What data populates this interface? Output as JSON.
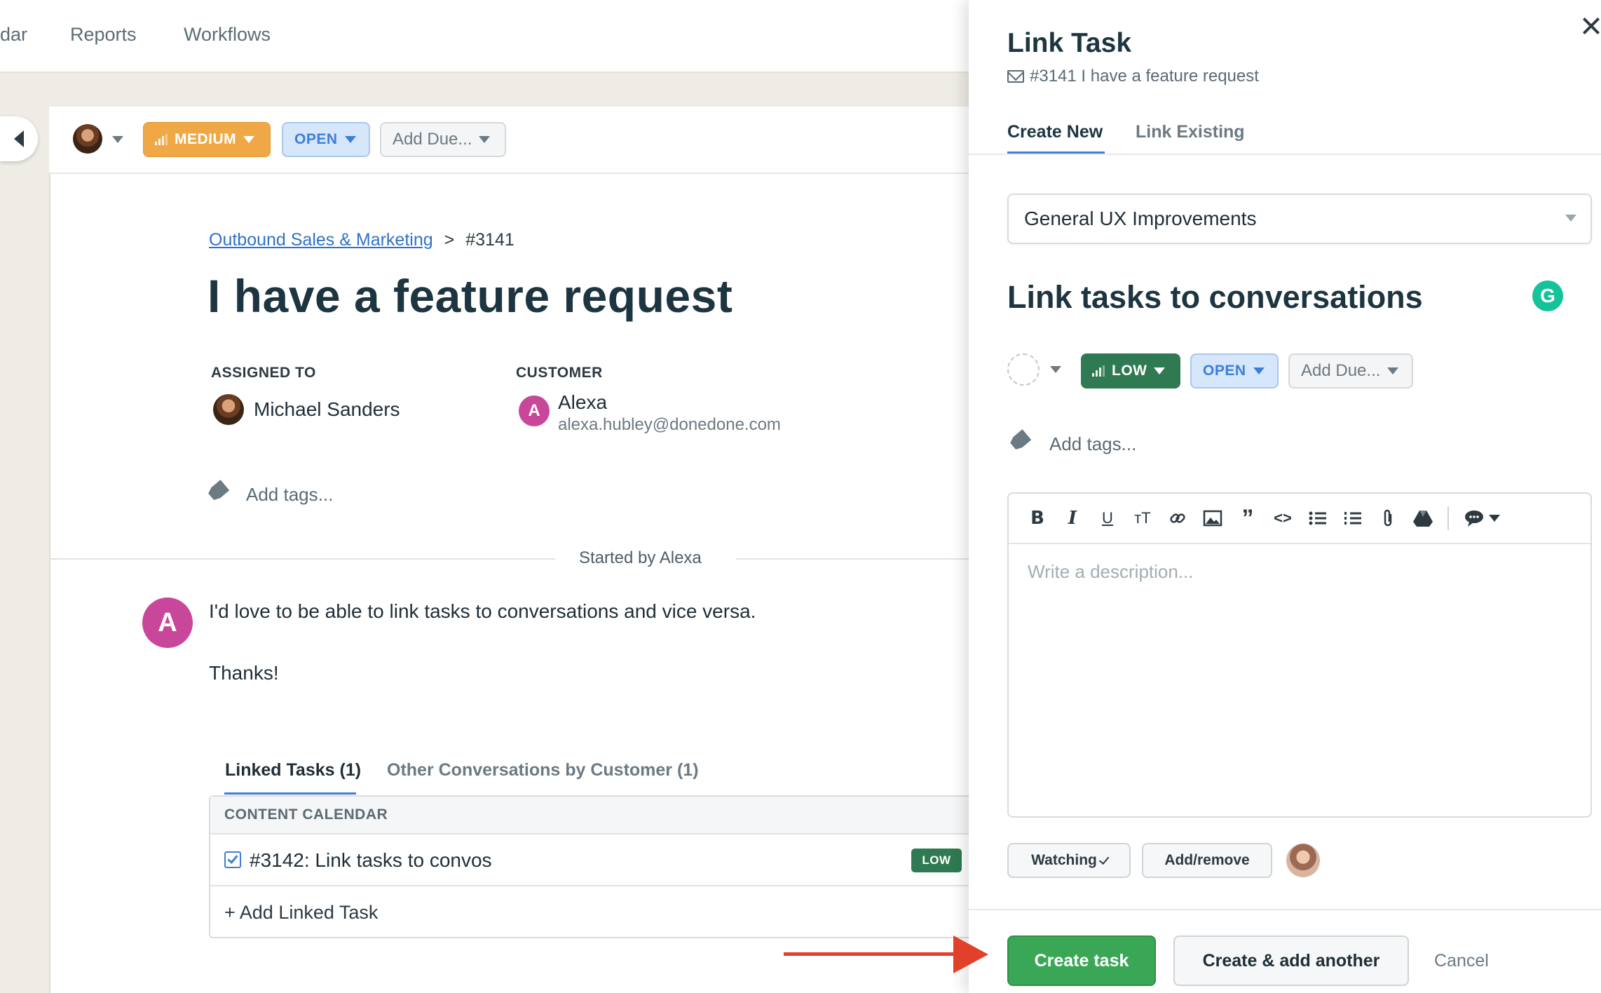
{
  "topnav": {
    "items": [
      "dar",
      "Reports",
      "Workflows"
    ]
  },
  "toolbar": {
    "priority": "MEDIUM",
    "status": "OPEN",
    "due": "Add Due..."
  },
  "breadcrumb": {
    "project": "Outbound Sales & Marketing",
    "separator": ">",
    "number": "#3141"
  },
  "conversation": {
    "title": "I have a feature request",
    "assigned_label": "ASSIGNED TO",
    "assignee": "Michael Sanders",
    "customer_label": "CUSTOMER",
    "customer_initial": "A",
    "customer_name": "Alexa",
    "customer_email": "alexa.hubley@donedone.com",
    "add_tags": "Add tags...",
    "started_by": "Started by Alexa",
    "message_initial": "A",
    "message_line1": "I'd love to be able to link tasks to conversations and vice versa.",
    "message_line2": "Thanks!"
  },
  "linked": {
    "tabs": [
      "Linked Tasks (1)",
      "Other Conversations by Customer (1)"
    ],
    "group": "CONTENT CALENDAR",
    "task": "#3142: Link tasks to convos",
    "task_priority": "LOW",
    "add_linked": "+ Add Linked Task"
  },
  "panel": {
    "title": "Link Task",
    "subtitle": "#3141 I have a feature request",
    "tabs": [
      "Create New",
      "Link Existing"
    ],
    "project": "General UX Improvements",
    "task_title": "Link tasks to conversations",
    "grammarly": "G",
    "priority": "LOW",
    "status": "OPEN",
    "due": "Add Due...",
    "add_tags": "Add tags...",
    "description_placeholder": "Write a description...",
    "watching": "Watching",
    "add_remove": "Add/remove",
    "create": "Create task",
    "create_another": "Create & add another",
    "cancel": "Cancel"
  },
  "colors": {
    "medium": "#f0a847",
    "open": "#3d7fd8",
    "low": "#2f7a52",
    "primary": "#3aa757",
    "avatar": "#c9479a",
    "arrow": "#e1402a"
  }
}
